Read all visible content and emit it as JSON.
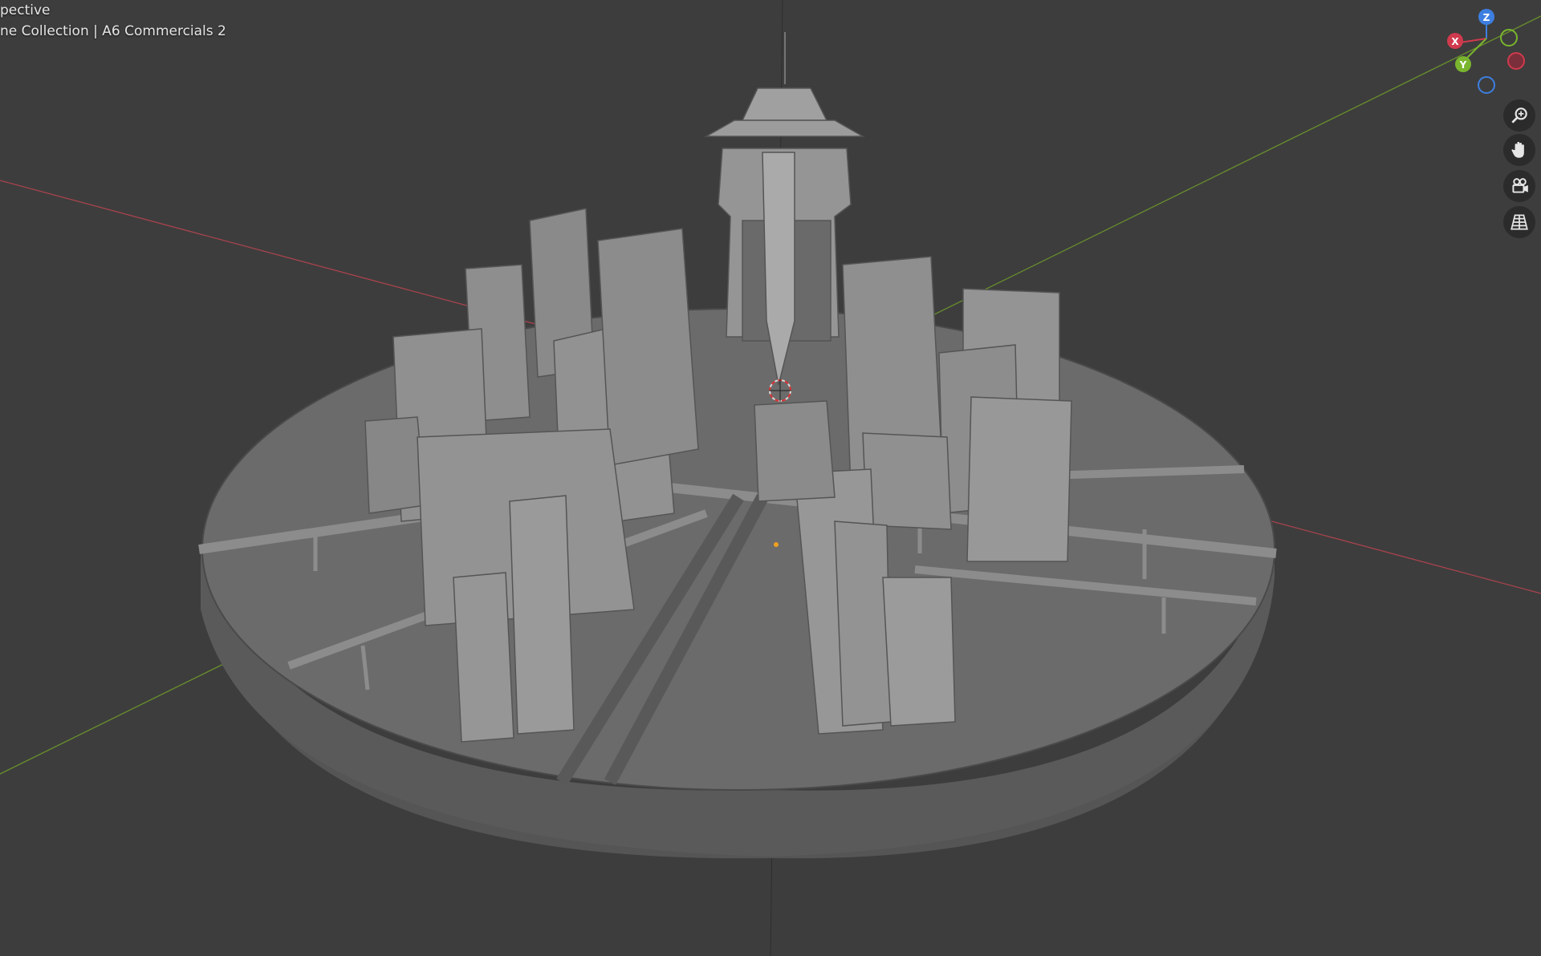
{
  "viewport": {
    "view_mode": "pective",
    "collection_path": "ne Collection | A6 Commercials 2"
  },
  "gizmo": {
    "axes": [
      {
        "name": "Z",
        "color": "#3d7fe0"
      },
      {
        "name": "X",
        "color": "#d03a4d"
      },
      {
        "name": "Y",
        "color": "#79b52e"
      }
    ]
  },
  "navigation": {
    "buttons": [
      {
        "icon": "zoom-icon"
      },
      {
        "icon": "hand-pan-icon"
      },
      {
        "icon": "camera-view-icon"
      },
      {
        "icon": "grid-ortho-icon"
      }
    ]
  },
  "colors": {
    "background": "#3d3d3d",
    "x_axis": "#b8414d",
    "y_axis": "#6a9a2a",
    "model_base": "#7a7a7a"
  }
}
